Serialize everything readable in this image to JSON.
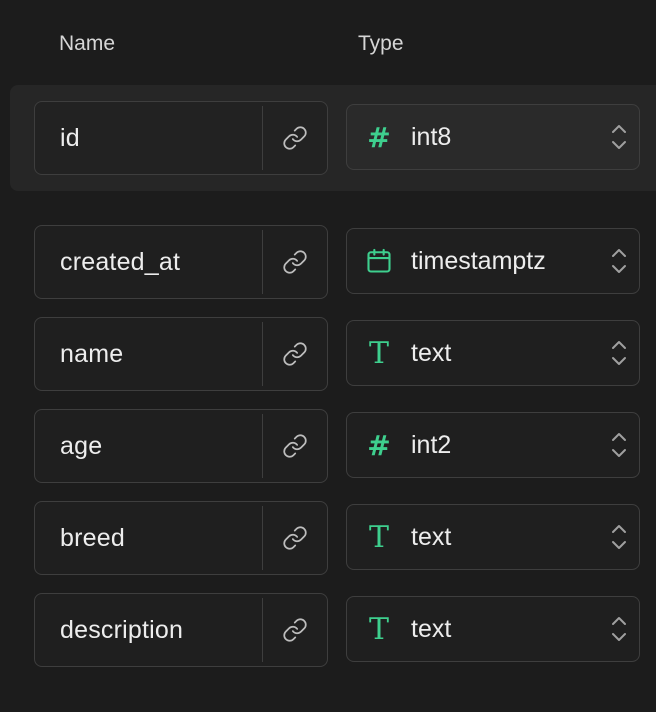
{
  "header": {
    "name_label": "Name",
    "type_label": "Type"
  },
  "columns": [
    {
      "name": "id",
      "type": "int8",
      "type_icon": "hash-icon",
      "primary": true
    },
    {
      "name": "created_at",
      "type": "timestamptz",
      "type_icon": "calendar-icon",
      "primary": false
    },
    {
      "name": "name",
      "type": "text",
      "type_icon": "text-type-icon",
      "primary": false
    },
    {
      "name": "age",
      "type": "int2",
      "type_icon": "hash-icon",
      "primary": false
    },
    {
      "name": "breed",
      "type": "text",
      "type_icon": "text-type-icon",
      "primary": false
    },
    {
      "name": "description",
      "type": "text",
      "type_icon": "text-type-icon",
      "primary": false
    }
  ],
  "colors": {
    "background": "#1c1c1c",
    "accent": "#3ecf8e",
    "border": "#3e3e3e",
    "text": "#ededed"
  }
}
